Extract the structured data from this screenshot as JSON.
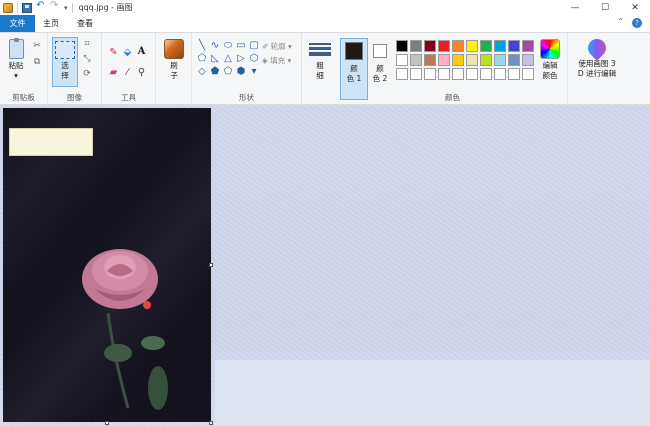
{
  "window": {
    "title": "qqq.jpg - 画图",
    "controls": {
      "minimize": "—",
      "maximize": "☐",
      "close": "✕"
    }
  },
  "tabs": {
    "file": "文件",
    "home": "主页",
    "view": "查看"
  },
  "ribbon": {
    "clipboard": {
      "label": "剪贴板",
      "paste": "粘贴",
      "paste_drop": "▾"
    },
    "image": {
      "label": "图像",
      "select": "选",
      "select2": "择"
    },
    "tools": {
      "label": "工具",
      "text_icon": "A"
    },
    "brushes": {
      "label1": "刷",
      "label2": "子"
    },
    "shapes": {
      "label": "形状",
      "outline": "轮廓",
      "fill": "填充",
      "glyphs": [
        "╲",
        "∿",
        "⬭",
        "▭",
        "▢",
        "⬠",
        "◺",
        "△",
        "▷",
        "⬡",
        "◇",
        "⬟",
        "⬠",
        "⬢",
        "▾"
      ]
    },
    "size": {
      "label1": "粗",
      "label2": "细"
    },
    "colors": {
      "label": "颜色",
      "color1_a": "颜",
      "color1_b": "色 1",
      "color2_a": "颜",
      "color2_b": "色 2",
      "color1_value": "#1b1b1b",
      "color2_value": "#ffffff",
      "edit_a": "编辑",
      "edit_b": "颜色",
      "paint3d_a": "使用画图 3",
      "paint3d_b": "D 进行编辑",
      "palette": [
        "#000000",
        "#7f7f7f",
        "#880015",
        "#ed1c24",
        "#ff7f27",
        "#fff200",
        "#22b14c",
        "#00a2e8",
        "#3f48cc",
        "#a349a4",
        "#ffffff",
        "#c3c3c3",
        "#b97a57",
        "#ffaec9",
        "#ffc90e",
        "#efe4b0",
        "#b5e61d",
        "#99d9ea",
        "#7092be",
        "#c8bfe7",
        "#ffffff",
        "#ffffff",
        "#ffffff",
        "#ffffff",
        "#ffffff",
        "#ffffff",
        "#ffffff",
        "#ffffff",
        "#ffffff",
        "#ffffff"
      ]
    }
  }
}
